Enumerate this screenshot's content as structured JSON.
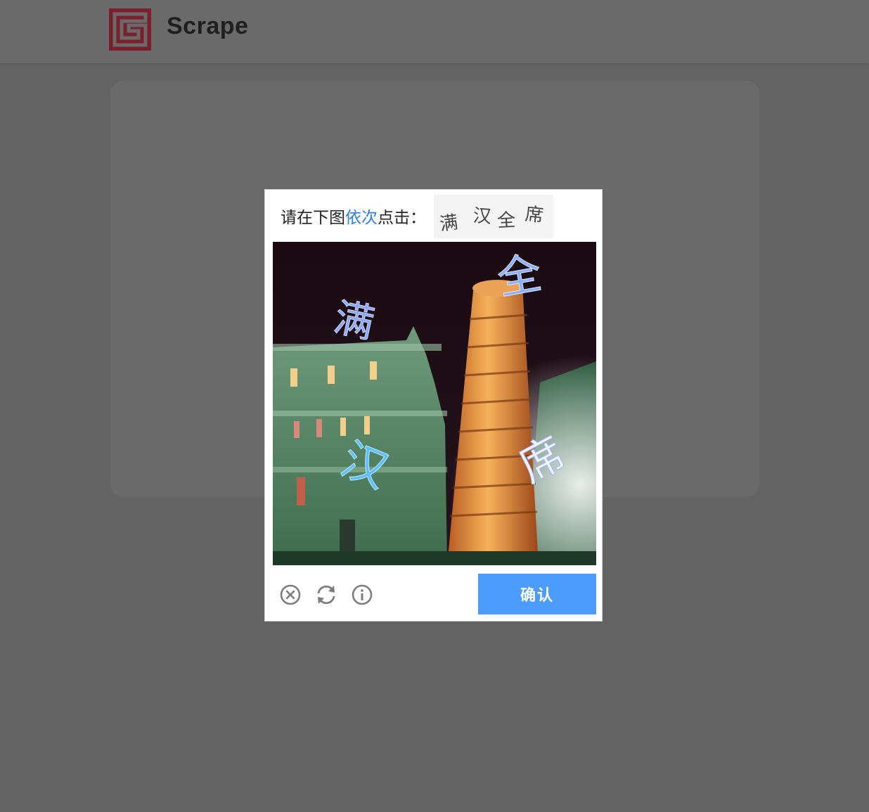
{
  "header": {
    "brand": "Scrape",
    "logo_icon": "scrape-logo-icon",
    "logo_color": "#7a1f2b"
  },
  "captcha": {
    "prompt_prefix": "请在下图",
    "prompt_highlight": "依次",
    "prompt_suffix": "点击：",
    "highlight_color": "#2f7fe5",
    "targets": [
      "满",
      "汉",
      "全",
      "席"
    ],
    "scene_chars": [
      "满",
      "汉",
      "全",
      "席"
    ],
    "image_subject": "leaning tower of pisa at night",
    "close_icon": "close-circle-icon",
    "refresh_icon": "refresh-icon",
    "info_icon": "info-icon",
    "confirm_label": "确认",
    "confirm_color": "#4d9cfb"
  }
}
